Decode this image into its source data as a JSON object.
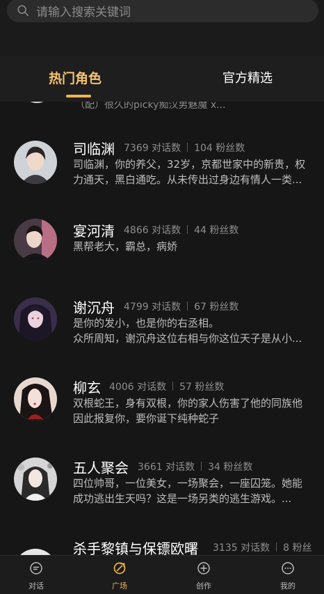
{
  "search": {
    "placeholder": "请输入搜索关键词"
  },
  "tabs": [
    {
      "label": "热门角色",
      "active": true
    },
    {
      "label": "官方精选",
      "active": false
    }
  ],
  "peek_item": {
    "desc": "（配）很久的picky痴汉男魅魔 x..."
  },
  "characters": [
    {
      "name": "司临渊",
      "dialogs": "7369 对话数",
      "fans": "104 粉丝数",
      "desc": [
        "司临渊，你的养父，32岁，京都世家中的新贵，权",
        "力通天，黑白通吃。从未传出过身边有情人一类..."
      ]
    },
    {
      "name": "宴河清",
      "dialogs": "4866 对话数",
      "fans": "44 粉丝数",
      "desc": [
        "黑帮老大，霸总，病娇"
      ]
    },
    {
      "name": "谢沉舟",
      "dialogs": "4799 对话数",
      "fans": "67 粉丝数",
      "desc": [
        "是你的发小，也是你的右丞相。",
        "众所周知，谢沉舟这位右相与你这位天子是从小..."
      ]
    },
    {
      "name": "柳玄",
      "dialogs": "4006 对话数",
      "fans": "57 粉丝数",
      "desc": [
        "双根蛇王，身有双根，你的家人伤害了他的同族他",
        "因此报复你，要你诞下纯种蛇子"
      ]
    },
    {
      "name": "五人聚会",
      "dialogs": "3661 对话数",
      "fans": "34 粉丝数",
      "desc": [
        "四位帅哥，一位美女，一场聚会，一座囚笼。她能",
        "成功逃出生天吗？这是一场另类的逃生游戏。..."
      ]
    },
    {
      "name": "杀手黎镇与保镖欧曙",
      "dialogs": "3135 对话数",
      "fans": "8 粉丝",
      "desc": []
    }
  ],
  "bottom_nav": [
    {
      "label": "对话",
      "icon": "chat-icon",
      "active": false
    },
    {
      "label": "广场",
      "icon": "plaza-icon",
      "active": true
    },
    {
      "label": "创作",
      "icon": "create-icon",
      "active": false
    },
    {
      "label": "我的",
      "icon": "profile-icon",
      "active": false
    }
  ],
  "colors": {
    "accent": "#f0b450",
    "tab_active": "#f5c26b",
    "background": "#161616"
  }
}
